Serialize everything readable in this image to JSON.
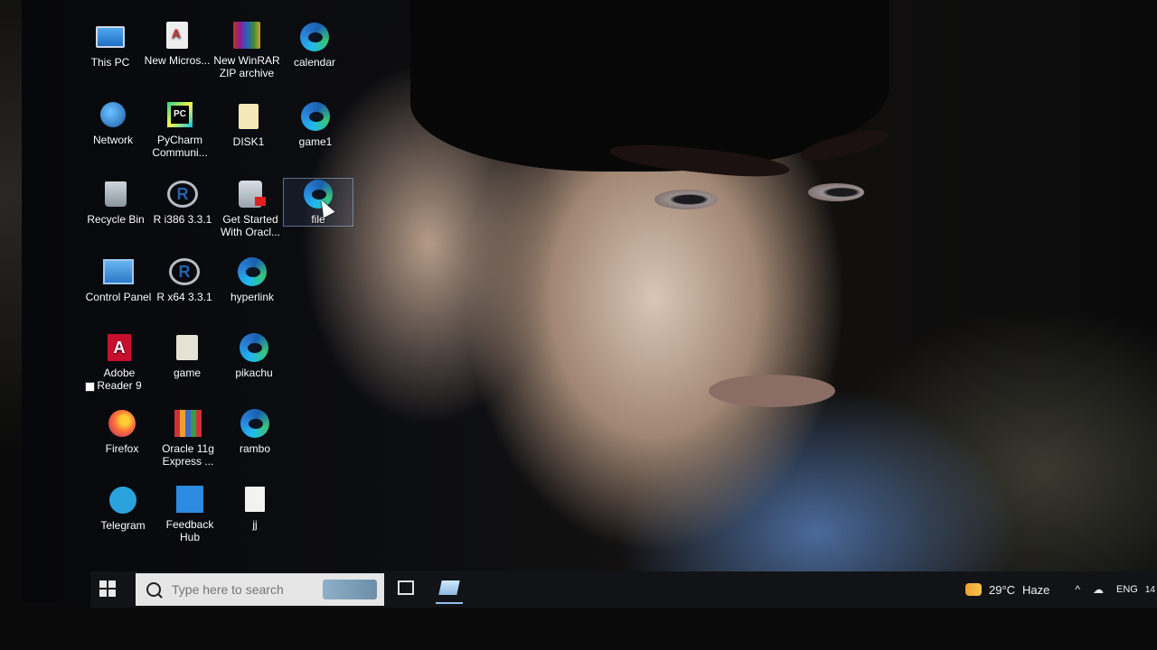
{
  "desktop": {
    "icons": [
      {
        "label": "This PC"
      },
      {
        "label": "New Micros..."
      },
      {
        "label": "New WinRAR ZIP archive"
      },
      {
        "label": "calendar"
      },
      {
        "label": "Network"
      },
      {
        "label": "PyCharm Communi..."
      },
      {
        "label": "DISK1"
      },
      {
        "label": "game1"
      },
      {
        "label": "Recycle Bin"
      },
      {
        "label": "R i386 3.3.1"
      },
      {
        "label": "Get Started With Oracl..."
      },
      {
        "label": "file"
      },
      {
        "label": "Control Panel"
      },
      {
        "label": "R x64 3.3.1"
      },
      {
        "label": "hyperlink"
      },
      {
        "label": "Adobe Reader 9"
      },
      {
        "label": "game"
      },
      {
        "label": "pikachu"
      },
      {
        "label": "Firefox"
      },
      {
        "label": "Oracle 11g Express ..."
      },
      {
        "label": "rambo"
      },
      {
        "label": "Telegram"
      },
      {
        "label": "Feedback Hub"
      },
      {
        "label": "jj"
      }
    ],
    "selected": "file"
  },
  "taskbar": {
    "search_placeholder": "Type here to search",
    "weather": {
      "temp": "29°C",
      "condition": "Haze"
    },
    "tray_chevron": "^",
    "language": "ENG",
    "clock": "14"
  }
}
